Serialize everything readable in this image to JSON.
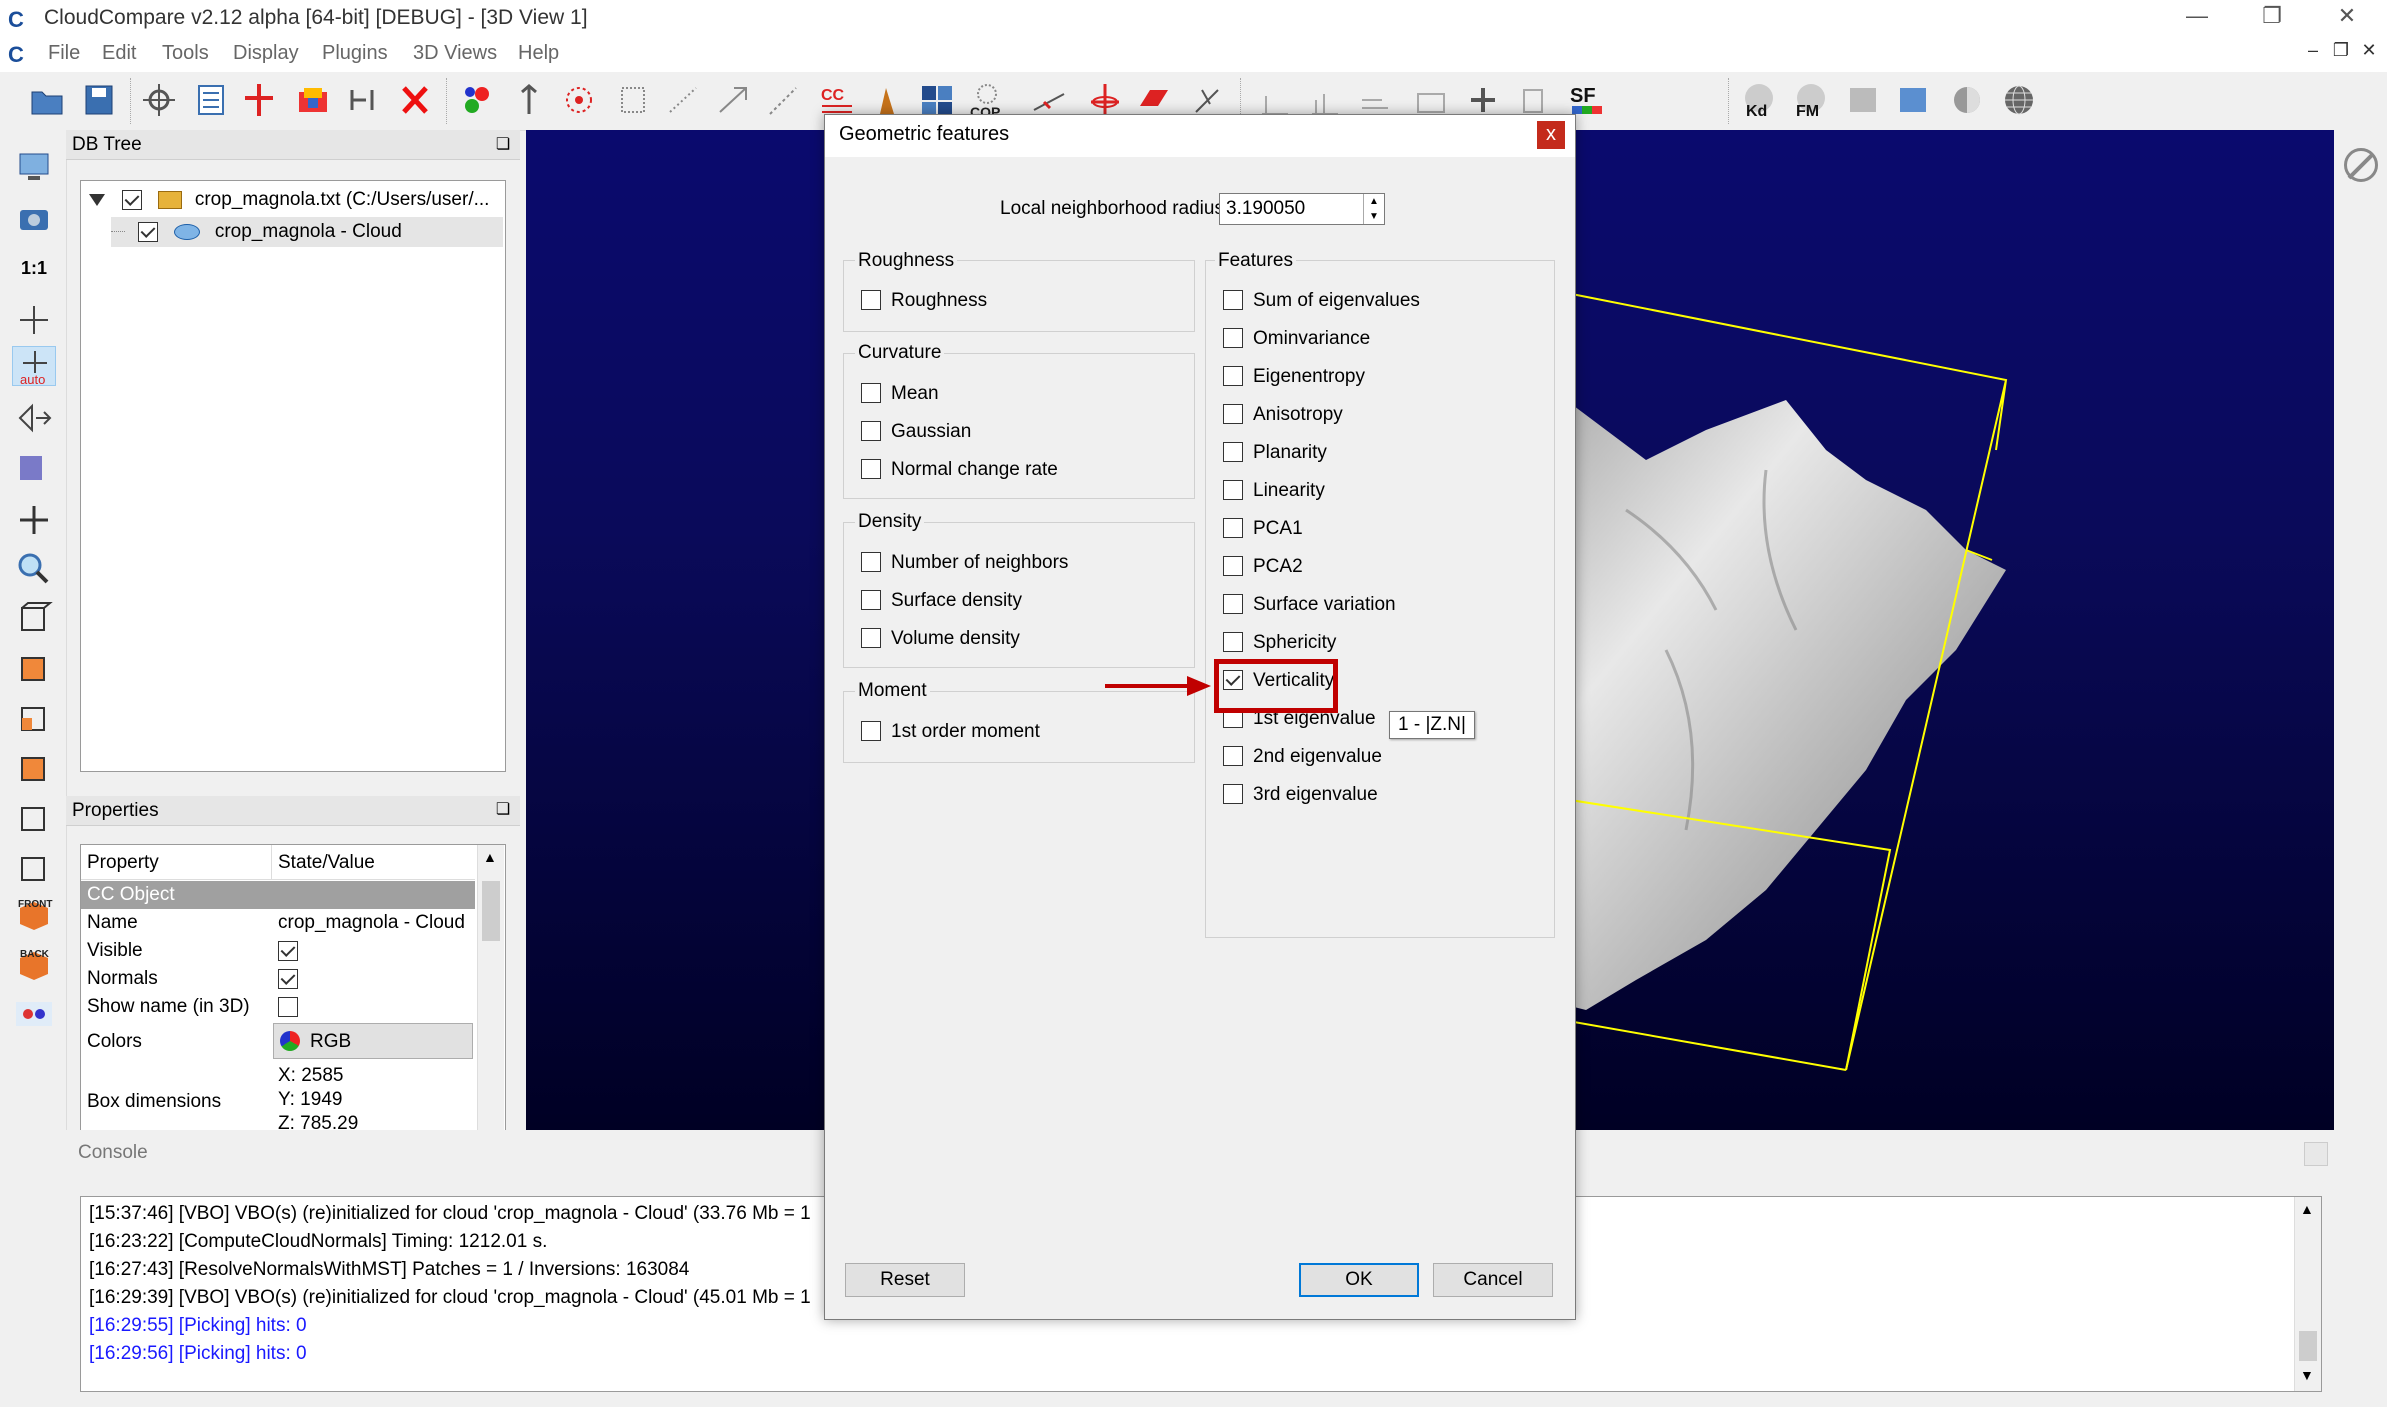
{
  "window": {
    "title": "CloudCompare v2.12 alpha [64-bit] [DEBUG] - [3D View 1]",
    "logo": "C"
  },
  "menu": [
    "File",
    "Edit",
    "Tools",
    "Display",
    "Plugins",
    "3D Views",
    "Help"
  ],
  "toolbar": {
    "sf_label": "SF",
    "kd_label": "Kd",
    "fm_label": "FM",
    "cc_label": "CC",
    "cop_label": "COP"
  },
  "left_toolbar": {
    "zoom_label": "1:1",
    "auto_label": "auto",
    "front_label": "FRONT",
    "back_label": "BACK"
  },
  "db_tree": {
    "title": "DB Tree",
    "items": [
      {
        "label": "crop_magnola.txt (C:/Users/user/...",
        "checked": true
      },
      {
        "label": "crop_magnola - Cloud",
        "checked": true
      }
    ]
  },
  "properties": {
    "title": "Properties",
    "headers": [
      "Property",
      "State/Value"
    ],
    "section": "CC Object",
    "rows": [
      {
        "name": "Name",
        "value": "crop_magnola - Cloud"
      },
      {
        "name": "Visible",
        "checked": true
      },
      {
        "name": "Normals",
        "checked": true
      },
      {
        "name": "Show name (in 3D)",
        "checked": false
      },
      {
        "name": "Colors",
        "value": "RGB"
      },
      {
        "name": "Box dimensions",
        "x": "X: 2585",
        "y": "Y: 1949",
        "z": "Z: 785.29"
      }
    ]
  },
  "console": {
    "title": "Console",
    "lines": [
      {
        "text": "[15:37:46] [VBO] VBO(s) (re)initialized for cloud 'crop_magnola - Cloud' (33.76 Mb = 1",
        "color": "#000000"
      },
      {
        "text": "[16:23:22] [ComputeCloudNormals] Timing: 1212.01 s.",
        "color": "#000000"
      },
      {
        "text": "[16:27:43] [ResolveNormalsWithMST] Patches = 1 / Inversions: 163084",
        "color": "#000000"
      },
      {
        "text": "[16:29:39] [VBO] VBO(s) (re)initialized for cloud 'crop_magnola - Cloud' (45.01 Mb = 1",
        "color": "#000000"
      },
      {
        "text": "[16:29:55] [Picking] hits: 0",
        "color": "#1a1aff"
      },
      {
        "text": "[16:29:56] [Picking] hits: 0",
        "color": "#1a1aff"
      }
    ]
  },
  "dialog": {
    "title": "Geometric features",
    "close": "x",
    "radius_label": "Local neighborhood radius",
    "radius_value": "3.190050",
    "groups": {
      "roughness": {
        "title": "Roughness",
        "options": [
          {
            "label": "Roughness",
            "checked": false
          }
        ]
      },
      "curvature": {
        "title": "Curvature",
        "options": [
          {
            "label": "Mean",
            "checked": false
          },
          {
            "label": "Gaussian",
            "checked": false
          },
          {
            "label": "Normal change rate",
            "checked": false
          }
        ]
      },
      "density": {
        "title": "Density",
        "options": [
          {
            "label": "Number of neighbors",
            "checked": false
          },
          {
            "label": "Surface density",
            "checked": false
          },
          {
            "label": "Volume density",
            "checked": false
          }
        ]
      },
      "moment": {
        "title": "Moment",
        "options": [
          {
            "label": "1st order moment",
            "checked": false
          }
        ]
      },
      "features": {
        "title": "Features",
        "options": [
          {
            "label": "Sum of eigenvalues",
            "checked": false
          },
          {
            "label": "Ominvariance",
            "checked": false
          },
          {
            "label": "Eigenentropy",
            "checked": false
          },
          {
            "label": "Anisotropy",
            "checked": false
          },
          {
            "label": "Planarity",
            "checked": false
          },
          {
            "label": "Linearity",
            "checked": false
          },
          {
            "label": "PCA1",
            "checked": false
          },
          {
            "label": "PCA2",
            "checked": false
          },
          {
            "label": "Surface variation",
            "checked": false
          },
          {
            "label": "Sphericity",
            "checked": false
          },
          {
            "label": "Verticality",
            "checked": true
          },
          {
            "label": "1st eigenvalue",
            "checked": false
          },
          {
            "label": "2nd eigenvalue",
            "checked": false
          },
          {
            "label": "3rd eigenvalue",
            "checked": false
          }
        ]
      }
    },
    "tooltip": "1 - |Z.N|",
    "buttons": {
      "reset": "Reset",
      "ok": "OK",
      "cancel": "Cancel"
    }
  },
  "colors": {
    "highlight": "#c00000",
    "accent": "#0078d7",
    "bbox": "#ffff00"
  }
}
